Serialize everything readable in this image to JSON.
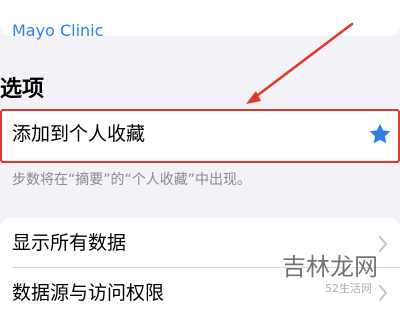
{
  "source": {
    "link_text": "Mayo Clinic"
  },
  "options": {
    "header": "选项",
    "add_to_favorites": "添加到个人收藏",
    "footnote": "步数将在“摘要”的“个人收藏”中出现。"
  },
  "data_section": {
    "items": [
      {
        "label": "显示所有数据"
      },
      {
        "label": "数据源与访问权限"
      }
    ]
  },
  "watermark": {
    "text": "吉林龙网",
    "sub": "52生活网"
  },
  "icons": {
    "favorite": "star-icon",
    "chevron": "chevron-right-icon"
  },
  "colors": {
    "link": "#2f7fe6",
    "star": "#2f7fe6",
    "highlight": "#d93a2b",
    "background": "#f2f2f7"
  }
}
